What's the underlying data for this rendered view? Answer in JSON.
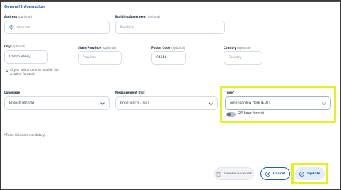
{
  "section": {
    "title": "General Information"
  },
  "address": {
    "label": "Address",
    "optional": "(optional)",
    "placeholder": "Address"
  },
  "building": {
    "label": "Building/Apartment",
    "optional": "(optional)",
    "placeholder": "Building"
  },
  "city": {
    "label": "City",
    "optional": "(optional)",
    "value": "Castro Valley"
  },
  "state": {
    "label": "State/Province",
    "optional": "(optional)",
    "placeholder": "Province"
  },
  "postal": {
    "label": "Postal Code",
    "optional": "(optional)",
    "value": "94546"
  },
  "country": {
    "label": "Country",
    "optional": "(optional)",
    "placeholder": "Country"
  },
  "city_hint": "City or postal code to provide the weather forecast",
  "language": {
    "label": "Language",
    "value": "English (en-US)"
  },
  "measurement": {
    "label": "Measurement Unit",
    "value": "Imperial (°F / lbs)"
  },
  "time": {
    "label": "Time*",
    "value": "America/New_York (EDT)"
  },
  "time_format": {
    "label": "24 hour format",
    "enabled": false
  },
  "required_note": "*These fields are mandatory.",
  "buttons": {
    "delete": "Delete Account",
    "cancel": "Cancel",
    "update": "Update"
  },
  "colors": {
    "accent": "#1d5fa8",
    "highlight": "#e6f01e"
  }
}
